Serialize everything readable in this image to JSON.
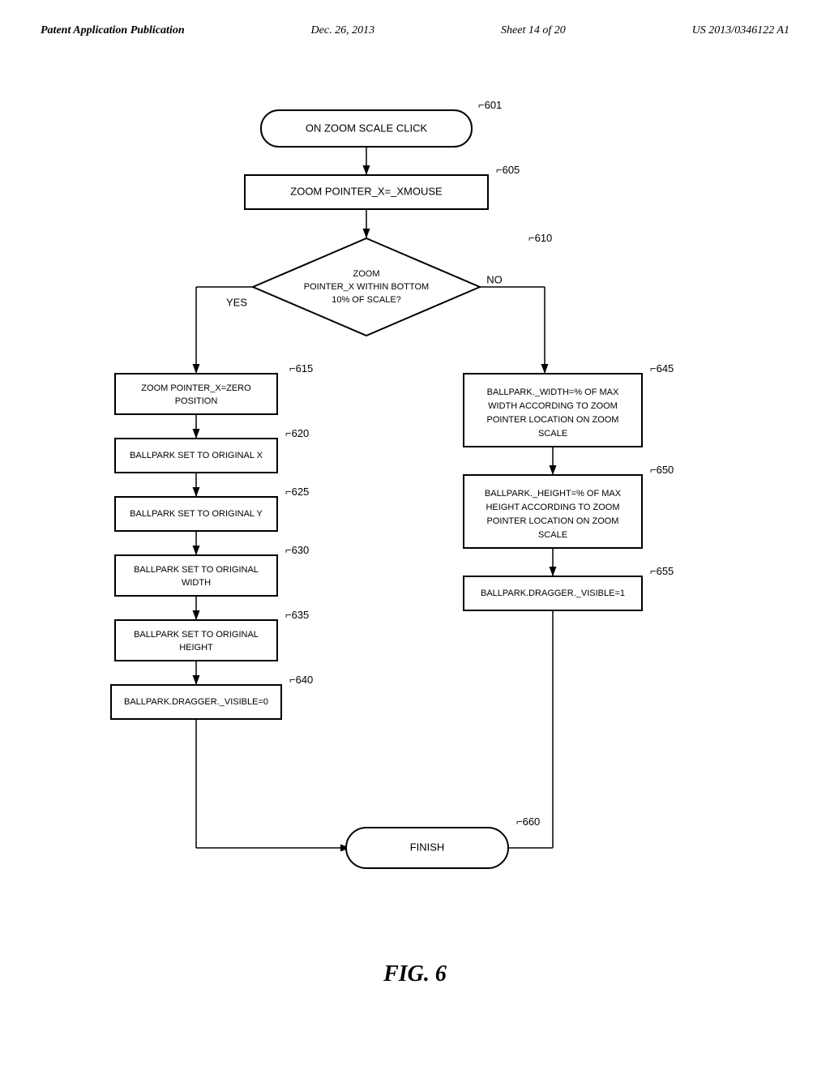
{
  "header": {
    "left": "Patent Application Publication",
    "center": "Dec. 26, 2013",
    "sheet": "Sheet 14 of 20",
    "right": "US 2013/0346122 A1"
  },
  "figure": {
    "caption": "FIG. 6"
  },
  "flowchart": {
    "nodes": [
      {
        "id": "601",
        "type": "rounded-rect",
        "label": "ON ZOOM SCALE CLICK",
        "ref": "601"
      },
      {
        "id": "605",
        "type": "rect",
        "label": "ZOOM POINTER_X=_XMOUSE",
        "ref": "605"
      },
      {
        "id": "610",
        "type": "diamond",
        "label": "ZOOM\nPOINTER_X WITHIN BOTTOM\n10% OF SCALE?",
        "ref": "610"
      },
      {
        "id": "615",
        "type": "rect",
        "label": "ZOOM POINTER_X=ZERO\nPOSITION",
        "ref": "615"
      },
      {
        "id": "620",
        "type": "rect",
        "label": "BALLPARK SET TO ORIGINAL X",
        "ref": "620"
      },
      {
        "id": "625",
        "type": "rect",
        "label": "BALLPARK SET TO ORIGINAL Y",
        "ref": "625"
      },
      {
        "id": "630",
        "type": "rect",
        "label": "BALLPARK SET TO ORIGINAL\nWIDTH",
        "ref": "630"
      },
      {
        "id": "635",
        "type": "rect",
        "label": "BALLPARK SET TO ORIGINAL\nHEIGHT",
        "ref": "635"
      },
      {
        "id": "640",
        "type": "rect",
        "label": "BALLPARK.DRAGGER._VISIBLE=0",
        "ref": "640"
      },
      {
        "id": "645",
        "type": "rect",
        "label": "BALLPARK._WIDTH=% OF MAX\nWIDTH ACCORDING TO ZOOM\nPOINTER LOCATION ON ZOOM\nSCALE",
        "ref": "645"
      },
      {
        "id": "650",
        "type": "rect",
        "label": "BALLPARK._HEIGHT=% OF MAX\nHEIGHT ACCORDING TO ZOOM\nPOINTER LOCATION ON ZOOM\nSCALE",
        "ref": "650"
      },
      {
        "id": "655",
        "type": "rect",
        "label": "BALLPARK.DRAGGER._VISIBLE=1",
        "ref": "655"
      },
      {
        "id": "660",
        "type": "rounded-rect",
        "label": "FINISH",
        "ref": "660"
      }
    ],
    "yes_label": "YES",
    "no_label": "NO"
  }
}
